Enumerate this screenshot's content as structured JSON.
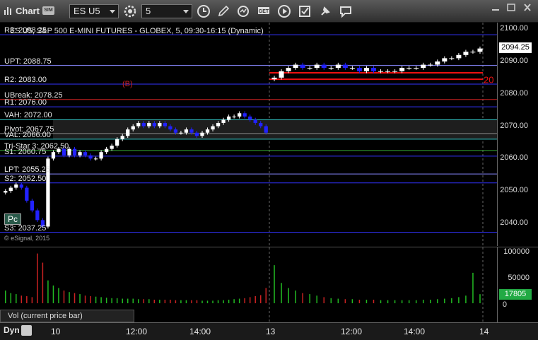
{
  "toolbar": {
    "title": "Chart",
    "sim_badge": "SIM",
    "symbol": "ES U5",
    "interval": "5",
    "icons": [
      "gear-icon",
      "clock-icon",
      "pencil-icon",
      "refresh-icon",
      "get-icon",
      "play-icon",
      "check-icon",
      "pin-icon",
      "comment-icon"
    ]
  },
  "chart": {
    "header": "ES U5, S&P 500 E-MINI FUTURES - GLOBEX, 5, 09:30-16:15 (Dynamic)",
    "copyright": "© eSignal, 2015",
    "pc_label": "Pc",
    "b_marker": "(B)",
    "levels": [
      {
        "label": "R3: 2098.25",
        "price": 2098.25,
        "color": "#3333ff"
      },
      {
        "label": "UPT: 2088.75",
        "price": 2088.75,
        "color": "#8888ff"
      },
      {
        "label": "R2: 2083.00",
        "price": 2083.0,
        "color": "#3333ff"
      },
      {
        "label": "UBreak: 2078.25",
        "price": 2078.25,
        "color": "#cc2222"
      },
      {
        "label": "R1: 2076.00",
        "price": 2076.0,
        "color": "#3333ff"
      },
      {
        "label": "VAH: 2072.00",
        "price": 2072.0,
        "color": "#33cccc"
      },
      {
        "label": "Pivot: 2067.75",
        "price": 2067.75,
        "color": "#888888"
      },
      {
        "label": "VAL: 2066.00",
        "price": 2066.0,
        "color": "#33cccc"
      },
      {
        "label": "Tri-Star 3: 2062.50",
        "price": 2062.5,
        "color": "#33aa33"
      },
      {
        "label": "S1: 2060.75",
        "price": 2060.75,
        "color": "#3333ff"
      },
      {
        "label": "LPT: 2055.25",
        "price": 2055.25,
        "color": "#8888ff"
      },
      {
        "label": "S2: 2052.50",
        "price": 2052.5,
        "color": "#3333ff"
      },
      {
        "label": "S3: 2037.25",
        "price": 2037.25,
        "color": "#3333ff"
      }
    ]
  },
  "price_axis": {
    "ticks": [
      "2100.00",
      "2090.00",
      "2080.00",
      "2070.00",
      "2060.00",
      "2050.00",
      "2040.00"
    ],
    "last_price": "2094.25",
    "last_price_color": "#ffffff"
  },
  "volume": {
    "title": "Vol (current price bar)",
    "ticks": [
      "100000",
      "50000",
      "0"
    ],
    "last_volume": "17805",
    "last_volume_color": "#22aa44"
  },
  "time_axis": {
    "mode": "Dyn",
    "labels": [
      "10",
      "12:00",
      "14:00",
      "13",
      "12:00",
      "14:00",
      "14"
    ]
  },
  "chart_data": {
    "type": "candlestick",
    "ylim": [
      2033,
      2102
    ],
    "annotation_20": "20",
    "closes_day1": [
      2050,
      2051,
      2052,
      2051,
      2047,
      2044,
      2041,
      2039,
      2060,
      2062,
      2063,
      2061,
      2063,
      2061,
      2062,
      2061,
      2060,
      2060,
      2062,
      2063,
      2064,
      2066,
      2067,
      2069,
      2070,
      2071,
      2070,
      2071,
      2070,
      2071,
      2070,
      2069,
      2068,
      2068,
      2069,
      2068,
      2067,
      2068,
      2069,
      2070,
      2071,
      2072,
      2073,
      2073,
      2074,
      2073,
      2072,
      2071,
      2070,
      2068
    ],
    "closes_day2": [
      2085,
      2087,
      2088,
      2089,
      2088,
      2088,
      2089,
      2088,
      2088,
      2089,
      2088,
      2088,
      2087,
      2088,
      2087,
      2087,
      2087,
      2087,
      2088,
      2088,
      2088,
      2089,
      2089,
      2090,
      2091,
      2091,
      2092,
      2093,
      2093,
      2094
    ],
    "volumes_day1": [
      25000,
      20000,
      18000,
      15000,
      14000,
      12000,
      98000,
      80000,
      45000,
      35000,
      30000,
      25000,
      22000,
      20000,
      18000,
      15000,
      14000,
      13000,
      12000,
      11000,
      10000,
      10000,
      9000,
      9000,
      9000,
      8000,
      8000,
      8000,
      7000,
      7000,
      7000,
      7000,
      6000,
      6000,
      6000,
      6000,
      6000,
      5000,
      5000,
      5000,
      6000,
      6000,
      7000,
      8000,
      9000,
      10000,
      12000,
      14000,
      16000,
      30000
    ],
    "volumes_day2": [
      75000,
      40000,
      30000,
      25000,
      20000,
      18000,
      15000,
      12000,
      10000,
      9000,
      8000,
      8000,
      7000,
      7000,
      7000,
      6000,
      6000,
      6000,
      6000,
      6000,
      6000,
      7000,
      7000,
      8000,
      9000,
      10000,
      12000,
      15000,
      60000,
      17805
    ]
  }
}
